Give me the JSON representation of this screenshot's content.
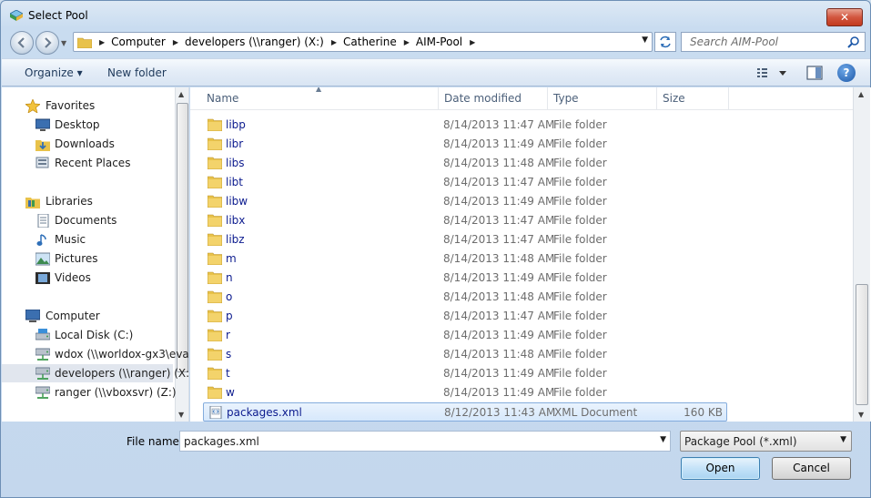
{
  "window": {
    "title": "Select Pool",
    "close_label": "✕"
  },
  "address": {
    "breadcrumbs": [
      "Computer",
      "developers (\\\\ranger) (X:)",
      "Catherine",
      "AIM-Pool"
    ]
  },
  "search": {
    "placeholder": "Search AIM-Pool"
  },
  "toolbar": {
    "organize_label": "Organize ▾",
    "new_folder_label": "New folder",
    "help_label": "?"
  },
  "nav": {
    "items": [
      {
        "label": "Favorites",
        "icon": "star-icon",
        "indent": 0
      },
      {
        "label": "Desktop",
        "icon": "desktop-icon",
        "indent": 1
      },
      {
        "label": "Downloads",
        "icon": "downloads-icon",
        "indent": 1
      },
      {
        "label": "Recent Places",
        "icon": "recent-places-icon",
        "indent": 1
      },
      {
        "label": "Libraries",
        "icon": "libraries-icon",
        "indent": 0
      },
      {
        "label": "Documents",
        "icon": "documents-icon",
        "indent": 1
      },
      {
        "label": "Music",
        "icon": "music-icon",
        "indent": 1
      },
      {
        "label": "Pictures",
        "icon": "pictures-icon",
        "indent": 1
      },
      {
        "label": "Videos",
        "icon": "videos-icon",
        "indent": 1
      },
      {
        "label": "Computer",
        "icon": "computer-icon",
        "indent": 0
      },
      {
        "label": "Local Disk (C:)",
        "icon": "local-disk-icon",
        "indent": 1
      },
      {
        "label": "wdox (\\\\worldox-gx3\\eva",
        "icon": "network-drive-icon",
        "indent": 1
      },
      {
        "label": "developers (\\\\ranger) (X:)",
        "icon": "network-drive-icon",
        "indent": 1,
        "selected": true
      },
      {
        "label": "ranger (\\\\vboxsvr) (Z:)",
        "icon": "network-drive-icon",
        "indent": 1
      }
    ]
  },
  "columns": {
    "name": "Name",
    "date": "Date modified",
    "type": "Type",
    "size": "Size"
  },
  "files": [
    {
      "name": "libp",
      "date": "8/14/2013 11:47 AM",
      "type": "File folder",
      "size": ""
    },
    {
      "name": "libr",
      "date": "8/14/2013 11:49 AM",
      "type": "File folder",
      "size": ""
    },
    {
      "name": "libs",
      "date": "8/14/2013 11:48 AM",
      "type": "File folder",
      "size": ""
    },
    {
      "name": "libt",
      "date": "8/14/2013 11:47 AM",
      "type": "File folder",
      "size": ""
    },
    {
      "name": "libw",
      "date": "8/14/2013 11:49 AM",
      "type": "File folder",
      "size": ""
    },
    {
      "name": "libx",
      "date": "8/14/2013 11:47 AM",
      "type": "File folder",
      "size": ""
    },
    {
      "name": "libz",
      "date": "8/14/2013 11:47 AM",
      "type": "File folder",
      "size": ""
    },
    {
      "name": "m",
      "date": "8/14/2013 11:48 AM",
      "type": "File folder",
      "size": ""
    },
    {
      "name": "n",
      "date": "8/14/2013 11:49 AM",
      "type": "File folder",
      "size": ""
    },
    {
      "name": "o",
      "date": "8/14/2013 11:48 AM",
      "type": "File folder",
      "size": ""
    },
    {
      "name": "p",
      "date": "8/14/2013 11:47 AM",
      "type": "File folder",
      "size": ""
    },
    {
      "name": "r",
      "date": "8/14/2013 11:49 AM",
      "type": "File folder",
      "size": ""
    },
    {
      "name": "s",
      "date": "8/14/2013 11:48 AM",
      "type": "File folder",
      "size": ""
    },
    {
      "name": "t",
      "date": "8/14/2013 11:49 AM",
      "type": "File folder",
      "size": ""
    },
    {
      "name": "w",
      "date": "8/14/2013 11:49 AM",
      "type": "File folder",
      "size": ""
    },
    {
      "name": "packages.xml",
      "date": "8/12/2013 11:43 AM",
      "type": "XML Document",
      "size": "160 KB",
      "selected": true
    }
  ],
  "footer": {
    "file_name_label": "File name:",
    "file_name_value": "packages.xml",
    "filter_value": "Package Pool (*.xml)",
    "open_label": "Open",
    "cancel_label": "Cancel"
  },
  "colors": {
    "folder": "#e8c24a",
    "link_text": "#0c1b8e",
    "selection": "#d6e8fc"
  }
}
